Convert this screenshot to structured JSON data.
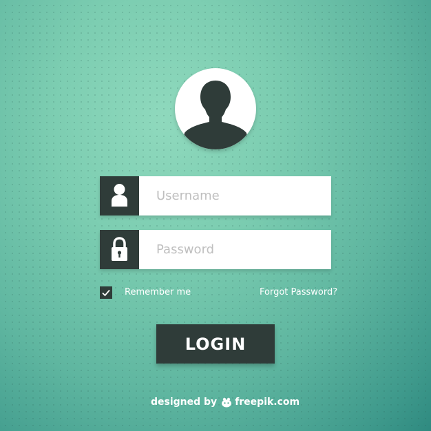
{
  "colors": {
    "dark_panel": "#2f3c39",
    "field_bg": "#ffffff",
    "placeholder": "#bfbfbf",
    "background_light": "#8fd9bd",
    "background_dark": "#2f8a80"
  },
  "avatar": {
    "icon": "user-silhouette-icon"
  },
  "form": {
    "username": {
      "icon": "user-icon",
      "value": "",
      "placeholder": "Username"
    },
    "password": {
      "icon": "lock-icon",
      "value": "",
      "placeholder": "Password"
    },
    "remember": {
      "label": "Remember me",
      "checked": true,
      "icon": "checkmark-icon"
    },
    "forgot_link": "Forgot Password?",
    "login_label": "LOGIN"
  },
  "footer": {
    "designed_by": "designed by",
    "brand": "freepik.com",
    "brand_icon": "freepik-logo-icon"
  }
}
